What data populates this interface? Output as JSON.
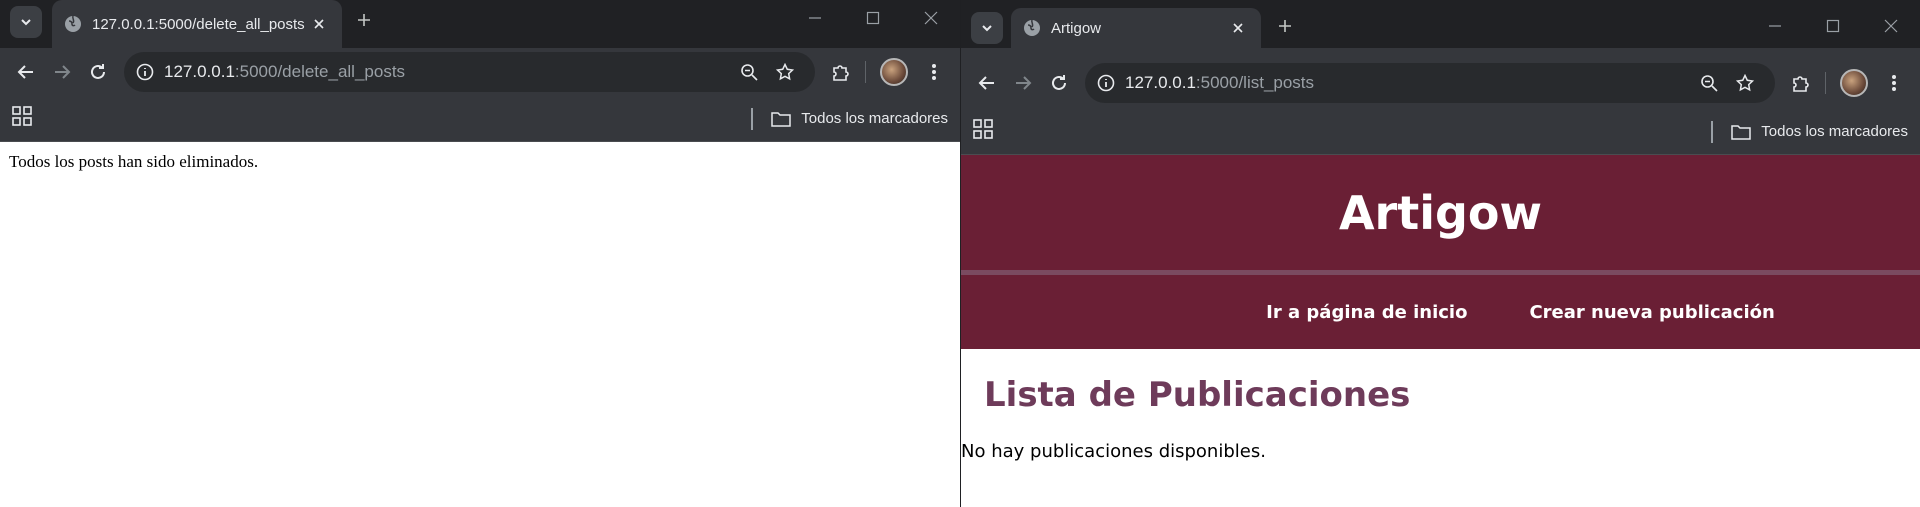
{
  "left": {
    "tab_title": "127.0.0.1:5000/delete_all_posts",
    "url_host": "127.0.0.1",
    "url_rest": ":5000/delete_all_posts",
    "bookmarks_label": "Todos los marcadores",
    "page_message": "Todos los posts han sido eliminados."
  },
  "right": {
    "tab_title": "Artigow",
    "url_host": "127.0.0.1",
    "url_rest": ":5000/list_posts",
    "bookmarks_label": "Todos los marcadores",
    "site": {
      "title": "Artigow",
      "nav": [
        {
          "label": "Ir a página de inicio"
        },
        {
          "label": "Crear nueva publicación"
        }
      ],
      "list_title": "Lista de Publicaciones",
      "empty_message": "No hay publicaciones disponibles."
    }
  },
  "colors": {
    "site_header": "#6a1f35",
    "list_title": "#6e3b5a",
    "chrome_dark": "#202124",
    "chrome_toolbar": "#35373c"
  }
}
